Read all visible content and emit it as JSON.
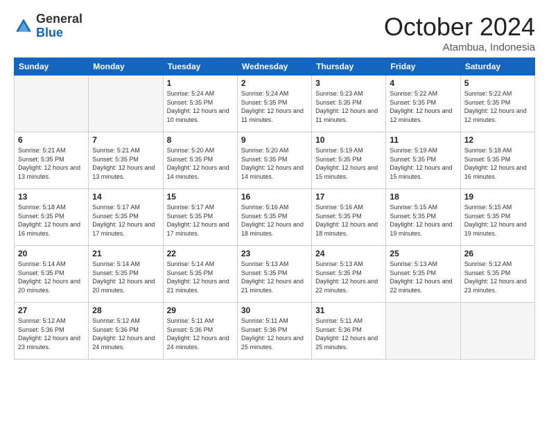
{
  "logo": {
    "general": "General",
    "blue": "Blue"
  },
  "header": {
    "month": "October 2024",
    "location": "Atambua, Indonesia"
  },
  "weekdays": [
    "Sunday",
    "Monday",
    "Tuesday",
    "Wednesday",
    "Thursday",
    "Friday",
    "Saturday"
  ],
  "weeks": [
    [
      {
        "day": "",
        "empty": true
      },
      {
        "day": "",
        "empty": true
      },
      {
        "day": "1",
        "sunrise": "5:24 AM",
        "sunset": "5:35 PM",
        "daylight": "12 hours and 10 minutes."
      },
      {
        "day": "2",
        "sunrise": "5:24 AM",
        "sunset": "5:35 PM",
        "daylight": "12 hours and 11 minutes."
      },
      {
        "day": "3",
        "sunrise": "5:23 AM",
        "sunset": "5:35 PM",
        "daylight": "12 hours and 11 minutes."
      },
      {
        "day": "4",
        "sunrise": "5:22 AM",
        "sunset": "5:35 PM",
        "daylight": "12 hours and 12 minutes."
      },
      {
        "day": "5",
        "sunrise": "5:22 AM",
        "sunset": "5:35 PM",
        "daylight": "12 hours and 12 minutes."
      }
    ],
    [
      {
        "day": "6",
        "sunrise": "5:21 AM",
        "sunset": "5:35 PM",
        "daylight": "12 hours and 13 minutes."
      },
      {
        "day": "7",
        "sunrise": "5:21 AM",
        "sunset": "5:35 PM",
        "daylight": "12 hours and 13 minutes."
      },
      {
        "day": "8",
        "sunrise": "5:20 AM",
        "sunset": "5:35 PM",
        "daylight": "12 hours and 14 minutes."
      },
      {
        "day": "9",
        "sunrise": "5:20 AM",
        "sunset": "5:35 PM",
        "daylight": "12 hours and 14 minutes."
      },
      {
        "day": "10",
        "sunrise": "5:19 AM",
        "sunset": "5:35 PM",
        "daylight": "12 hours and 15 minutes."
      },
      {
        "day": "11",
        "sunrise": "5:19 AM",
        "sunset": "5:35 PM",
        "daylight": "12 hours and 15 minutes."
      },
      {
        "day": "12",
        "sunrise": "5:18 AM",
        "sunset": "5:35 PM",
        "daylight": "12 hours and 16 minutes."
      }
    ],
    [
      {
        "day": "13",
        "sunrise": "5:18 AM",
        "sunset": "5:35 PM",
        "daylight": "12 hours and 16 minutes."
      },
      {
        "day": "14",
        "sunrise": "5:17 AM",
        "sunset": "5:35 PM",
        "daylight": "12 hours and 17 minutes."
      },
      {
        "day": "15",
        "sunrise": "5:17 AM",
        "sunset": "5:35 PM",
        "daylight": "12 hours and 17 minutes."
      },
      {
        "day": "16",
        "sunrise": "5:16 AM",
        "sunset": "5:35 PM",
        "daylight": "12 hours and 18 minutes."
      },
      {
        "day": "17",
        "sunrise": "5:16 AM",
        "sunset": "5:35 PM",
        "daylight": "12 hours and 18 minutes."
      },
      {
        "day": "18",
        "sunrise": "5:15 AM",
        "sunset": "5:35 PM",
        "daylight": "12 hours and 19 minutes."
      },
      {
        "day": "19",
        "sunrise": "5:15 AM",
        "sunset": "5:35 PM",
        "daylight": "12 hours and 19 minutes."
      }
    ],
    [
      {
        "day": "20",
        "sunrise": "5:14 AM",
        "sunset": "5:35 PM",
        "daylight": "12 hours and 20 minutes."
      },
      {
        "day": "21",
        "sunrise": "5:14 AM",
        "sunset": "5:35 PM",
        "daylight": "12 hours and 20 minutes."
      },
      {
        "day": "22",
        "sunrise": "5:14 AM",
        "sunset": "5:35 PM",
        "daylight": "12 hours and 21 minutes."
      },
      {
        "day": "23",
        "sunrise": "5:13 AM",
        "sunset": "5:35 PM",
        "daylight": "12 hours and 21 minutes."
      },
      {
        "day": "24",
        "sunrise": "5:13 AM",
        "sunset": "5:35 PM",
        "daylight": "12 hours and 22 minutes."
      },
      {
        "day": "25",
        "sunrise": "5:13 AM",
        "sunset": "5:35 PM",
        "daylight": "12 hours and 22 minutes."
      },
      {
        "day": "26",
        "sunrise": "5:12 AM",
        "sunset": "5:35 PM",
        "daylight": "12 hours and 23 minutes."
      }
    ],
    [
      {
        "day": "27",
        "sunrise": "5:12 AM",
        "sunset": "5:36 PM",
        "daylight": "12 hours and 23 minutes."
      },
      {
        "day": "28",
        "sunrise": "5:12 AM",
        "sunset": "5:36 PM",
        "daylight": "12 hours and 24 minutes."
      },
      {
        "day": "29",
        "sunrise": "5:11 AM",
        "sunset": "5:36 PM",
        "daylight": "12 hours and 24 minutes."
      },
      {
        "day": "30",
        "sunrise": "5:11 AM",
        "sunset": "5:36 PM",
        "daylight": "12 hours and 25 minutes."
      },
      {
        "day": "31",
        "sunrise": "5:11 AM",
        "sunset": "5:36 PM",
        "daylight": "12 hours and 25 minutes."
      },
      {
        "day": "",
        "empty": true
      },
      {
        "day": "",
        "empty": true
      }
    ]
  ],
  "labels": {
    "sunrise": "Sunrise:",
    "sunset": "Sunset:",
    "daylight": "Daylight:"
  }
}
